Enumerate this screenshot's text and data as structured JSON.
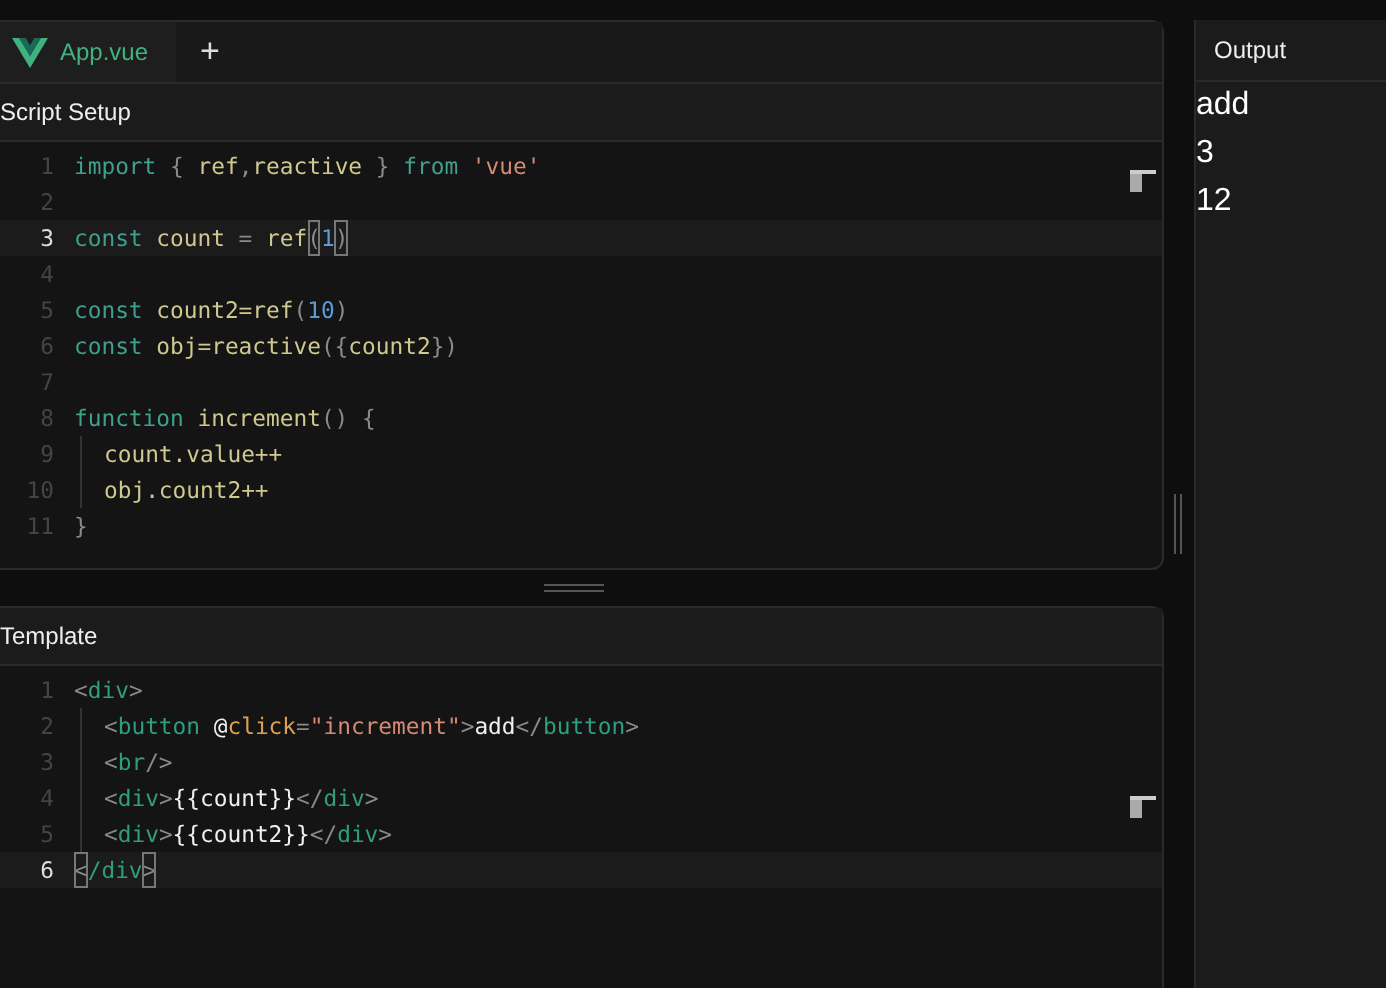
{
  "tabs": [
    {
      "label": "App.vue",
      "selected": true
    }
  ],
  "add_tab": "+",
  "editors": [
    {
      "title": "Script Setup",
      "lines": [
        {
          "num": "1",
          "active": false,
          "tokens": [
            {
              "kind": "keyword",
              "text": "import"
            },
            {
              "kind": "punct",
              "text": " { "
            },
            {
              "kind": "var",
              "text": "ref"
            },
            {
              "kind": "punct",
              "text": ","
            },
            {
              "kind": "var",
              "text": "reactive"
            },
            {
              "kind": "punct",
              "text": " }"
            },
            {
              "kind": "keyword",
              "text": " from"
            },
            {
              "kind": "string",
              "text": " 'vue'"
            }
          ]
        },
        {
          "num": "2",
          "active": false
        },
        {
          "num": "3",
          "active": true,
          "tokens": [
            {
              "kind": "keyword",
              "text": "const"
            },
            {
              "kind": "var",
              "text": " count"
            },
            {
              "kind": "punct",
              "text": " = "
            },
            {
              "kind": "var",
              "text": "ref"
            },
            {
              "kind": "match",
              "text": "("
            },
            {
              "kind": "number",
              "text": "1"
            },
            {
              "kind": "match",
              "text": ")"
            }
          ]
        },
        {
          "num": "4",
          "active": false
        },
        {
          "num": "5",
          "active": false,
          "tokens": [
            {
              "kind": "keyword",
              "text": "const"
            },
            {
              "kind": "var",
              "text": " count2=ref"
            },
            {
              "kind": "punct",
              "text": "("
            },
            {
              "kind": "number",
              "text": "10"
            },
            {
              "kind": "punct",
              "text": ")"
            }
          ]
        },
        {
          "num": "6",
          "active": false,
          "tokens": [
            {
              "kind": "keyword",
              "text": "const"
            },
            {
              "kind": "var",
              "text": " obj=reactive"
            },
            {
              "kind": "punct",
              "text": "({"
            },
            {
              "kind": "var",
              "text": "count2"
            },
            {
              "kind": "punct",
              "text": "})"
            }
          ]
        },
        {
          "num": "7",
          "active": false
        },
        {
          "num": "8",
          "active": false,
          "tokens": [
            {
              "kind": "keyword",
              "text": "function"
            },
            {
              "kind": "var",
              "text": " increment"
            },
            {
              "kind": "punct",
              "text": "() {"
            }
          ]
        },
        {
          "num": "9",
          "active": false,
          "indent": true,
          "tokens": [
            {
              "kind": "var",
              "text": "count.value++"
            }
          ]
        },
        {
          "num": "10",
          "active": false,
          "indent": true,
          "tokens": [
            {
              "kind": "var",
              "text": "obj.count2++"
            }
          ]
        },
        {
          "num": "11",
          "active": false,
          "tokens": [
            {
              "kind": "punct",
              "text": "}"
            }
          ]
        }
      ]
    },
    {
      "title": "Template",
      "lines": [
        {
          "num": "1",
          "active": false,
          "tokens": [
            {
              "kind": "punct",
              "text": "<"
            },
            {
              "kind": "tag",
              "text": "div"
            },
            {
              "kind": "punct",
              "text": ">"
            }
          ]
        },
        {
          "num": "2",
          "active": false,
          "indent": true,
          "tokens": [
            {
              "kind": "punct",
              "text": "<"
            },
            {
              "kind": "tag",
              "text": "button"
            },
            {
              "kind": "text",
              "text": " @"
            },
            {
              "kind": "attr",
              "text": "click"
            },
            {
              "kind": "punct",
              "text": "="
            },
            {
              "kind": "string",
              "text": "\"increment\""
            },
            {
              "kind": "punct",
              "text": ">"
            },
            {
              "kind": "text",
              "text": "add"
            },
            {
              "kind": "punct",
              "text": "</"
            },
            {
              "kind": "tag",
              "text": "button"
            },
            {
              "kind": "punct",
              "text": ">"
            }
          ]
        },
        {
          "num": "3",
          "active": false,
          "indent": true,
          "tokens": [
            {
              "kind": "punct",
              "text": "<"
            },
            {
              "kind": "tag",
              "text": "br"
            },
            {
              "kind": "punct",
              "text": "/>"
            }
          ]
        },
        {
          "num": "4",
          "active": false,
          "indent": true,
          "tokens": [
            {
              "kind": "punct",
              "text": "<"
            },
            {
              "kind": "tag",
              "text": "div"
            },
            {
              "kind": "punct",
              "text": ">"
            },
            {
              "kind": "text",
              "text": "{{count}}"
            },
            {
              "kind": "punct",
              "text": "</"
            },
            {
              "kind": "tag",
              "text": "div"
            },
            {
              "kind": "punct",
              "text": ">"
            }
          ]
        },
        {
          "num": "5",
          "active": false,
          "indent": true,
          "tokens": [
            {
              "kind": "punct",
              "text": "<"
            },
            {
              "kind": "tag",
              "text": "div"
            },
            {
              "kind": "punct",
              "text": ">"
            },
            {
              "kind": "text",
              "text": "{{count2}}"
            },
            {
              "kind": "punct",
              "text": "</"
            },
            {
              "kind": "tag",
              "text": "div"
            },
            {
              "kind": "punct",
              "text": ">"
            }
          ]
        },
        {
          "num": "6",
          "active": true,
          "tokens": [
            {
              "kind": "match",
              "text": "<"
            },
            {
              "kind": "tag",
              "text": "/div"
            },
            {
              "kind": "match",
              "text": ">"
            }
          ]
        }
      ]
    }
  ],
  "output": {
    "title": "Output",
    "lines": [
      "add",
      "3",
      "12"
    ]
  }
}
